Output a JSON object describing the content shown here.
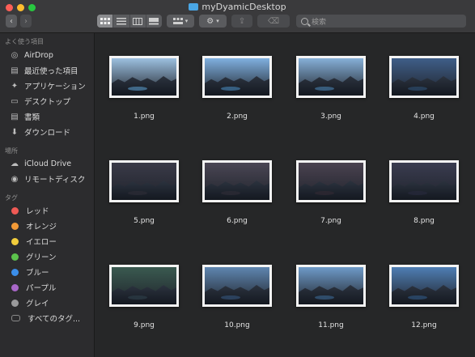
{
  "window": {
    "title": "myDyamicDesktop"
  },
  "toolbar": {
    "back_glyph": "‹",
    "forward_glyph": "›",
    "search_placeholder": "検索",
    "action_glyph": "⚙",
    "arrange_glyph": "▾",
    "share_glyph": "⇪",
    "tag_glyph": "⌫"
  },
  "sidebar": {
    "favorites_header": "よく使う項目",
    "favorites": [
      {
        "label": "AirDrop",
        "icon": "airdrop-icon",
        "glyph": "◎"
      },
      {
        "label": "最近使った項目",
        "icon": "recents-icon",
        "glyph": "▤"
      },
      {
        "label": "アプリケーション",
        "icon": "applications-icon",
        "glyph": "✦"
      },
      {
        "label": "デスクトップ",
        "icon": "desktop-icon",
        "glyph": "▭"
      },
      {
        "label": "書類",
        "icon": "documents-icon",
        "glyph": "▤"
      },
      {
        "label": "ダウンロード",
        "icon": "downloads-icon",
        "glyph": "⬇"
      }
    ],
    "locations_header": "場所",
    "locations": [
      {
        "label": "iCloud Drive",
        "icon": "cloud-icon",
        "glyph": "☁"
      },
      {
        "label": "リモートディスク",
        "icon": "remote-disc-icon",
        "glyph": "◉"
      }
    ],
    "tags_header": "タグ",
    "tags": [
      {
        "label": "レッド",
        "color": "#ef5a55"
      },
      {
        "label": "オレンジ",
        "color": "#f39a37"
      },
      {
        "label": "イエロー",
        "color": "#f2cd3c"
      },
      {
        "label": "グリーン",
        "color": "#5cc24c"
      },
      {
        "label": "ブルー",
        "color": "#3b8ee9"
      },
      {
        "label": "パープル",
        "color": "#a867c8"
      },
      {
        "label": "グレイ",
        "color": "#9a9a9c"
      },
      {
        "label": "すべてのタグ...",
        "color": ""
      }
    ]
  },
  "files": [
    {
      "name": "1.png",
      "sky": "#9cc0e0",
      "lake": "#4a7aa0"
    },
    {
      "name": "2.png",
      "sky": "#7fb0e0",
      "lake": "#3d6e96"
    },
    {
      "name": "3.png",
      "sky": "#86b0d8",
      "lake": "#3f6a90"
    },
    {
      "name": "4.png",
      "sky": "#3f5e88",
      "lake": "#2a4664"
    },
    {
      "name": "5.png",
      "sky": "#3a3a48",
      "lake": "#2a2a34"
    },
    {
      "name": "6.png",
      "sky": "#4a4654",
      "lake": "#2c2a34"
    },
    {
      "name": "7.png",
      "sky": "#4a4250",
      "lake": "#2e2832"
    },
    {
      "name": "8.png",
      "sky": "#3a3c50",
      "lake": "#26283a"
    },
    {
      "name": "9.png",
      "sky": "#3a5a50",
      "lake": "#2a3a44"
    },
    {
      "name": "10.png",
      "sky": "#5f86b0",
      "lake": "#2f4a6a"
    },
    {
      "name": "11.png",
      "sky": "#6e9ac8",
      "lake": "#34577a"
    },
    {
      "name": "12.png",
      "sky": "#4f7eb4",
      "lake": "#2c4c70"
    }
  ]
}
